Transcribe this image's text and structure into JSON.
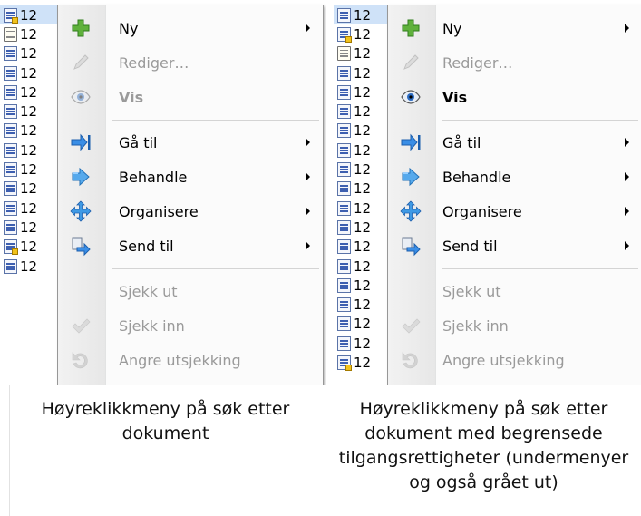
{
  "filelist": {
    "truncated_name": "12",
    "left_icons": [
      "word-locked",
      "note",
      "word",
      "word",
      "word",
      "word",
      "word",
      "word",
      "word",
      "word",
      "word",
      "word",
      "word-locked",
      "word"
    ],
    "right_icons": [
      "word",
      "word-locked",
      "note",
      "word",
      "word",
      "word",
      "word",
      "word",
      "word",
      "word",
      "word",
      "word",
      "word",
      "word",
      "word",
      "word",
      "word",
      "word",
      "word-locked"
    ]
  },
  "left_menu": {
    "items": [
      {
        "icon": "plus-icon",
        "label": "Ny",
        "submenu": true,
        "disabled": false,
        "bold": false
      },
      {
        "icon": "pencil-icon",
        "label": "Rediger…",
        "submenu": false,
        "disabled": true,
        "bold": false
      },
      {
        "icon": "eye-icon",
        "label": "Vis",
        "submenu": false,
        "disabled": true,
        "bold": true
      },
      {
        "separator": true
      },
      {
        "icon": "goto-arrow-icon",
        "label": "Gå til",
        "submenu": true,
        "disabled": false,
        "bold": false
      },
      {
        "icon": "process-arrow-icon",
        "label": "Behandle",
        "submenu": true,
        "disabled": false,
        "bold": false
      },
      {
        "icon": "organize-move-icon",
        "label": "Organisere",
        "submenu": true,
        "disabled": false,
        "bold": false
      },
      {
        "icon": "send-to-icon",
        "label": "Send til",
        "submenu": true,
        "disabled": false,
        "bold": false
      },
      {
        "separator": true
      },
      {
        "icon": "none",
        "label": "Sjekk ut",
        "submenu": false,
        "disabled": true,
        "bold": false
      },
      {
        "icon": "checkmark-icon",
        "label": "Sjekk inn",
        "submenu": false,
        "disabled": true,
        "bold": false
      },
      {
        "icon": "undo-icon",
        "label": "Angre utsjekking",
        "submenu": false,
        "disabled": true,
        "bold": false
      }
    ]
  },
  "right_menu": {
    "items": [
      {
        "icon": "plus-icon",
        "label": "Ny",
        "submenu": true,
        "disabled": false,
        "bold": false
      },
      {
        "icon": "pencil-icon",
        "label": "Rediger…",
        "submenu": false,
        "disabled": true,
        "bold": false
      },
      {
        "icon": "eye-icon",
        "label": "Vis",
        "submenu": false,
        "disabled": false,
        "bold": true
      },
      {
        "separator": true
      },
      {
        "icon": "goto-arrow-icon",
        "label": "Gå til",
        "submenu": true,
        "disabled": false,
        "bold": false
      },
      {
        "icon": "process-arrow-icon",
        "label": "Behandle",
        "submenu": true,
        "disabled": false,
        "bold": false
      },
      {
        "icon": "organize-move-icon",
        "label": "Organisere",
        "submenu": true,
        "disabled": false,
        "bold": false
      },
      {
        "icon": "send-to-icon",
        "label": "Send til",
        "submenu": true,
        "disabled": false,
        "bold": false
      },
      {
        "separator": true
      },
      {
        "icon": "none",
        "label": "Sjekk ut",
        "submenu": false,
        "disabled": true,
        "bold": false
      },
      {
        "icon": "checkmark-icon",
        "label": "Sjekk inn",
        "submenu": false,
        "disabled": true,
        "bold": false
      },
      {
        "icon": "undo-icon",
        "label": "Angre utsjekking",
        "submenu": false,
        "disabled": true,
        "bold": false
      }
    ]
  },
  "captions": {
    "left": "Høyreklikkmeny på søk etter dokument",
    "right": "Høyreklikkmeny på søk etter dokument med begrensede tilgangsrettigheter (undermenyer og også grået ut)"
  },
  "colors": {
    "enabled_text": "#000000",
    "disabled_text": "#9a9a9a",
    "selection": "#cfe2f8",
    "menu_border": "#979797"
  }
}
